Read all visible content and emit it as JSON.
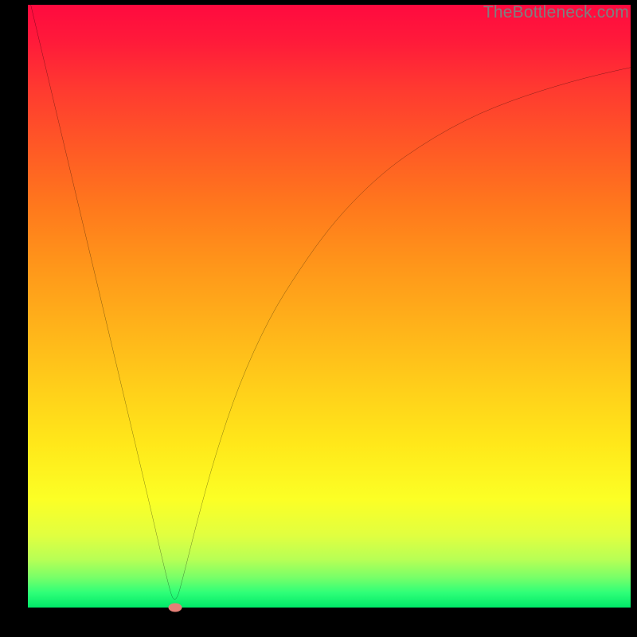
{
  "watermark": "TheBottleneck.com",
  "chart_data": {
    "type": "line",
    "title": "",
    "xlabel": "",
    "ylabel": "",
    "xlim": [
      0,
      100
    ],
    "ylim": [
      0,
      100
    ],
    "grid": false,
    "legend": false,
    "series": [
      {
        "name": "bottleneck-curve",
        "x": [
          0,
          5,
          10,
          15,
          20,
          23,
          24.4,
          26,
          28,
          31,
          35,
          40,
          45,
          50,
          55,
          60,
          65,
          70,
          75,
          80,
          85,
          90,
          95,
          100
        ],
        "values": [
          102,
          81,
          60,
          39,
          18,
          5,
          0,
          6,
          14,
          25,
          37,
          48,
          56,
          63,
          68.5,
          73,
          76.5,
          79.5,
          82,
          84,
          85.7,
          87.2,
          88.5,
          89.6
        ]
      }
    ],
    "marker": {
      "x": 24.4,
      "y": 0,
      "color": "#e58077"
    },
    "background_gradient_top": "#ff0a3f",
    "background_gradient_bottom": "#00e868",
    "curve_color": "#000000"
  }
}
